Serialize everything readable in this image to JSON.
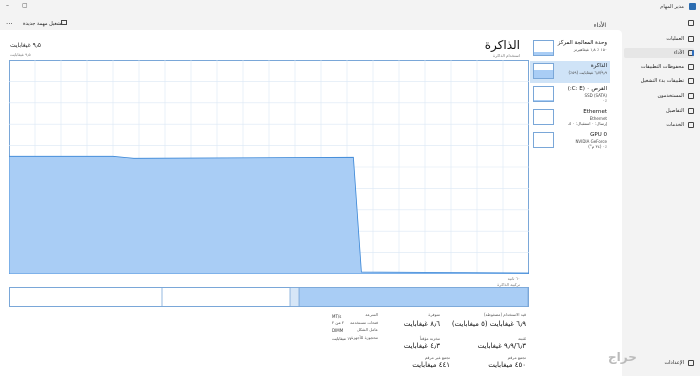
{
  "app": {
    "title": "مدير المهام"
  },
  "toolbar": {
    "run_task_label": "تشغيل مهمة جديدة",
    "more_label": "..."
  },
  "sidebar": {
    "items": [
      {
        "label": "العمليات",
        "icon": "grid-icon"
      },
      {
        "label": "الأداء",
        "icon": "performance-icon",
        "active": true
      },
      {
        "label": "محفوظات التطبيقات",
        "icon": "history-icon"
      },
      {
        "label": "تطبيقات بدء التشغيل",
        "icon": "startup-icon"
      },
      {
        "label": "المستخدمون",
        "icon": "users-icon"
      },
      {
        "label": "التفاصيل",
        "icon": "details-icon"
      },
      {
        "label": "الخدمات",
        "icon": "services-icon"
      }
    ],
    "settings_label": "الإعدادات"
  },
  "performance": {
    "title": "الأداء"
  },
  "devices": [
    {
      "name": "وحدة المعالجة المركز",
      "sub": "١٥٠ ٪ ١٫٨ غيغاهيرتز",
      "sub2": "",
      "level": 0.2
    },
    {
      "name": "الذاكرة",
      "sub": "٦٫٧/٩٫٩ غيغابايت (٥٩٪)",
      "sub2": "",
      "level": 0.55,
      "active": true
    },
    {
      "name": "القرص ٠ (C: E:)",
      "sub": "SSD (SATA)",
      "sub2": "٪٠",
      "level": 0.05
    },
    {
      "name": "Ethernet",
      "sub": "Ethernet",
      "sub2": "إرسال: ٠ استقبال: ٠ ك",
      "level": 0.0
    },
    {
      "name": "GPU 0",
      "sub": "NVIDIA GeForce",
      "sub2": "٪٠ (٣٤ م°)",
      "level": 0.0
    }
  ],
  "memory": {
    "title": "الذاكرة",
    "total": "٩٫٥ غيغابايت",
    "chart_caption_right": "استخدام الذاكرة",
    "chart_caption_left": "٩٫٥ غيغابايت",
    "x_axis_left": "٦٠ ثانية",
    "x_axis_right": "٠",
    "composition_caption": "تركيبة الذاكرة",
    "usage_level": 0.55,
    "usage_drop_at": 0.33
  },
  "stats": {
    "in_use_label": "قيد الاستخدام (مضغوطة)",
    "in_use_value": "٦٫٩ غيغابايت (٥ ميغابايت)",
    "available_label": "متوفرة",
    "available_value": "٨٫٦ غيغابايت",
    "committed_label": "مُثبتة",
    "committed_value": "٩٫٩/٦٫٣ غيغابايت",
    "cached_label": "مخزنة مؤقتاً",
    "cached_value": "٤٫٣ غيغابايت",
    "paged_label": "تجمع مرقم",
    "paged_value": "٤٥٠ ميغابايت",
    "nonpaged_label": "تجمع غير مرقم",
    "nonpaged_value": "٤٤١ ميغابايت",
    "speed_label": "السرعة",
    "speed_value": "",
    "slots_label": "فتحات مستخدمة",
    "slots_value": "٢ من ٢",
    "form_label": "عامل الشكل",
    "form_value": "DIMM",
    "reserved_label": "محجوزة للأجهزة",
    "reserved_value": "١٧٠ ميغابايت",
    "speed_right_label": "MT/s"
  },
  "watermark": "حراج"
}
